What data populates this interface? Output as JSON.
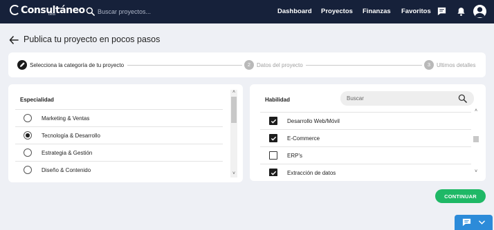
{
  "header": {
    "logo_text": "Consultáneo",
    "logo_badge": "beta",
    "search_placeholder": "Buscar proyectos...",
    "nav": [
      "Dashboard",
      "Proyectos",
      "Finanzas",
      "Favoritos"
    ],
    "bg_color": "#16213a"
  },
  "page": {
    "title": "Publica tu proyecto en pocos pasos"
  },
  "stepper": {
    "steps": [
      {
        "number": "1",
        "label": "Selecciona la categoría de tu proyecto",
        "state": "active"
      },
      {
        "number": "2",
        "label": "Datos del proyecto",
        "state": "pending"
      },
      {
        "number": "3",
        "label": "Ultimos detalles",
        "state": "pending"
      }
    ]
  },
  "specialty": {
    "title": "Especialidad",
    "options": [
      {
        "label": "Marketing & Ventas",
        "selected": false
      },
      {
        "label": "Tecnología & Desarrollo",
        "selected": true
      },
      {
        "label": "Estrategia & Gestión",
        "selected": false
      },
      {
        "label": "Diseño & Contenido",
        "selected": false
      }
    ]
  },
  "skills": {
    "title": "Habilidad",
    "search_placeholder": "Buscar",
    "items": [
      {
        "label": "Desarrollo Web/Móvil",
        "checked": true
      },
      {
        "label": "E-Commerce",
        "checked": true
      },
      {
        "label": "ERP's",
        "checked": false
      },
      {
        "label": "Extracción de datos",
        "checked": true
      }
    ]
  },
  "actions": {
    "continue_label": "CONTINUAR",
    "accent_color": "#1fb866"
  },
  "icons": [
    "search-icon",
    "chat-icon",
    "bell-icon",
    "user-avatar",
    "back-arrow-icon",
    "edit-icon",
    "chevron-down-icon"
  ]
}
